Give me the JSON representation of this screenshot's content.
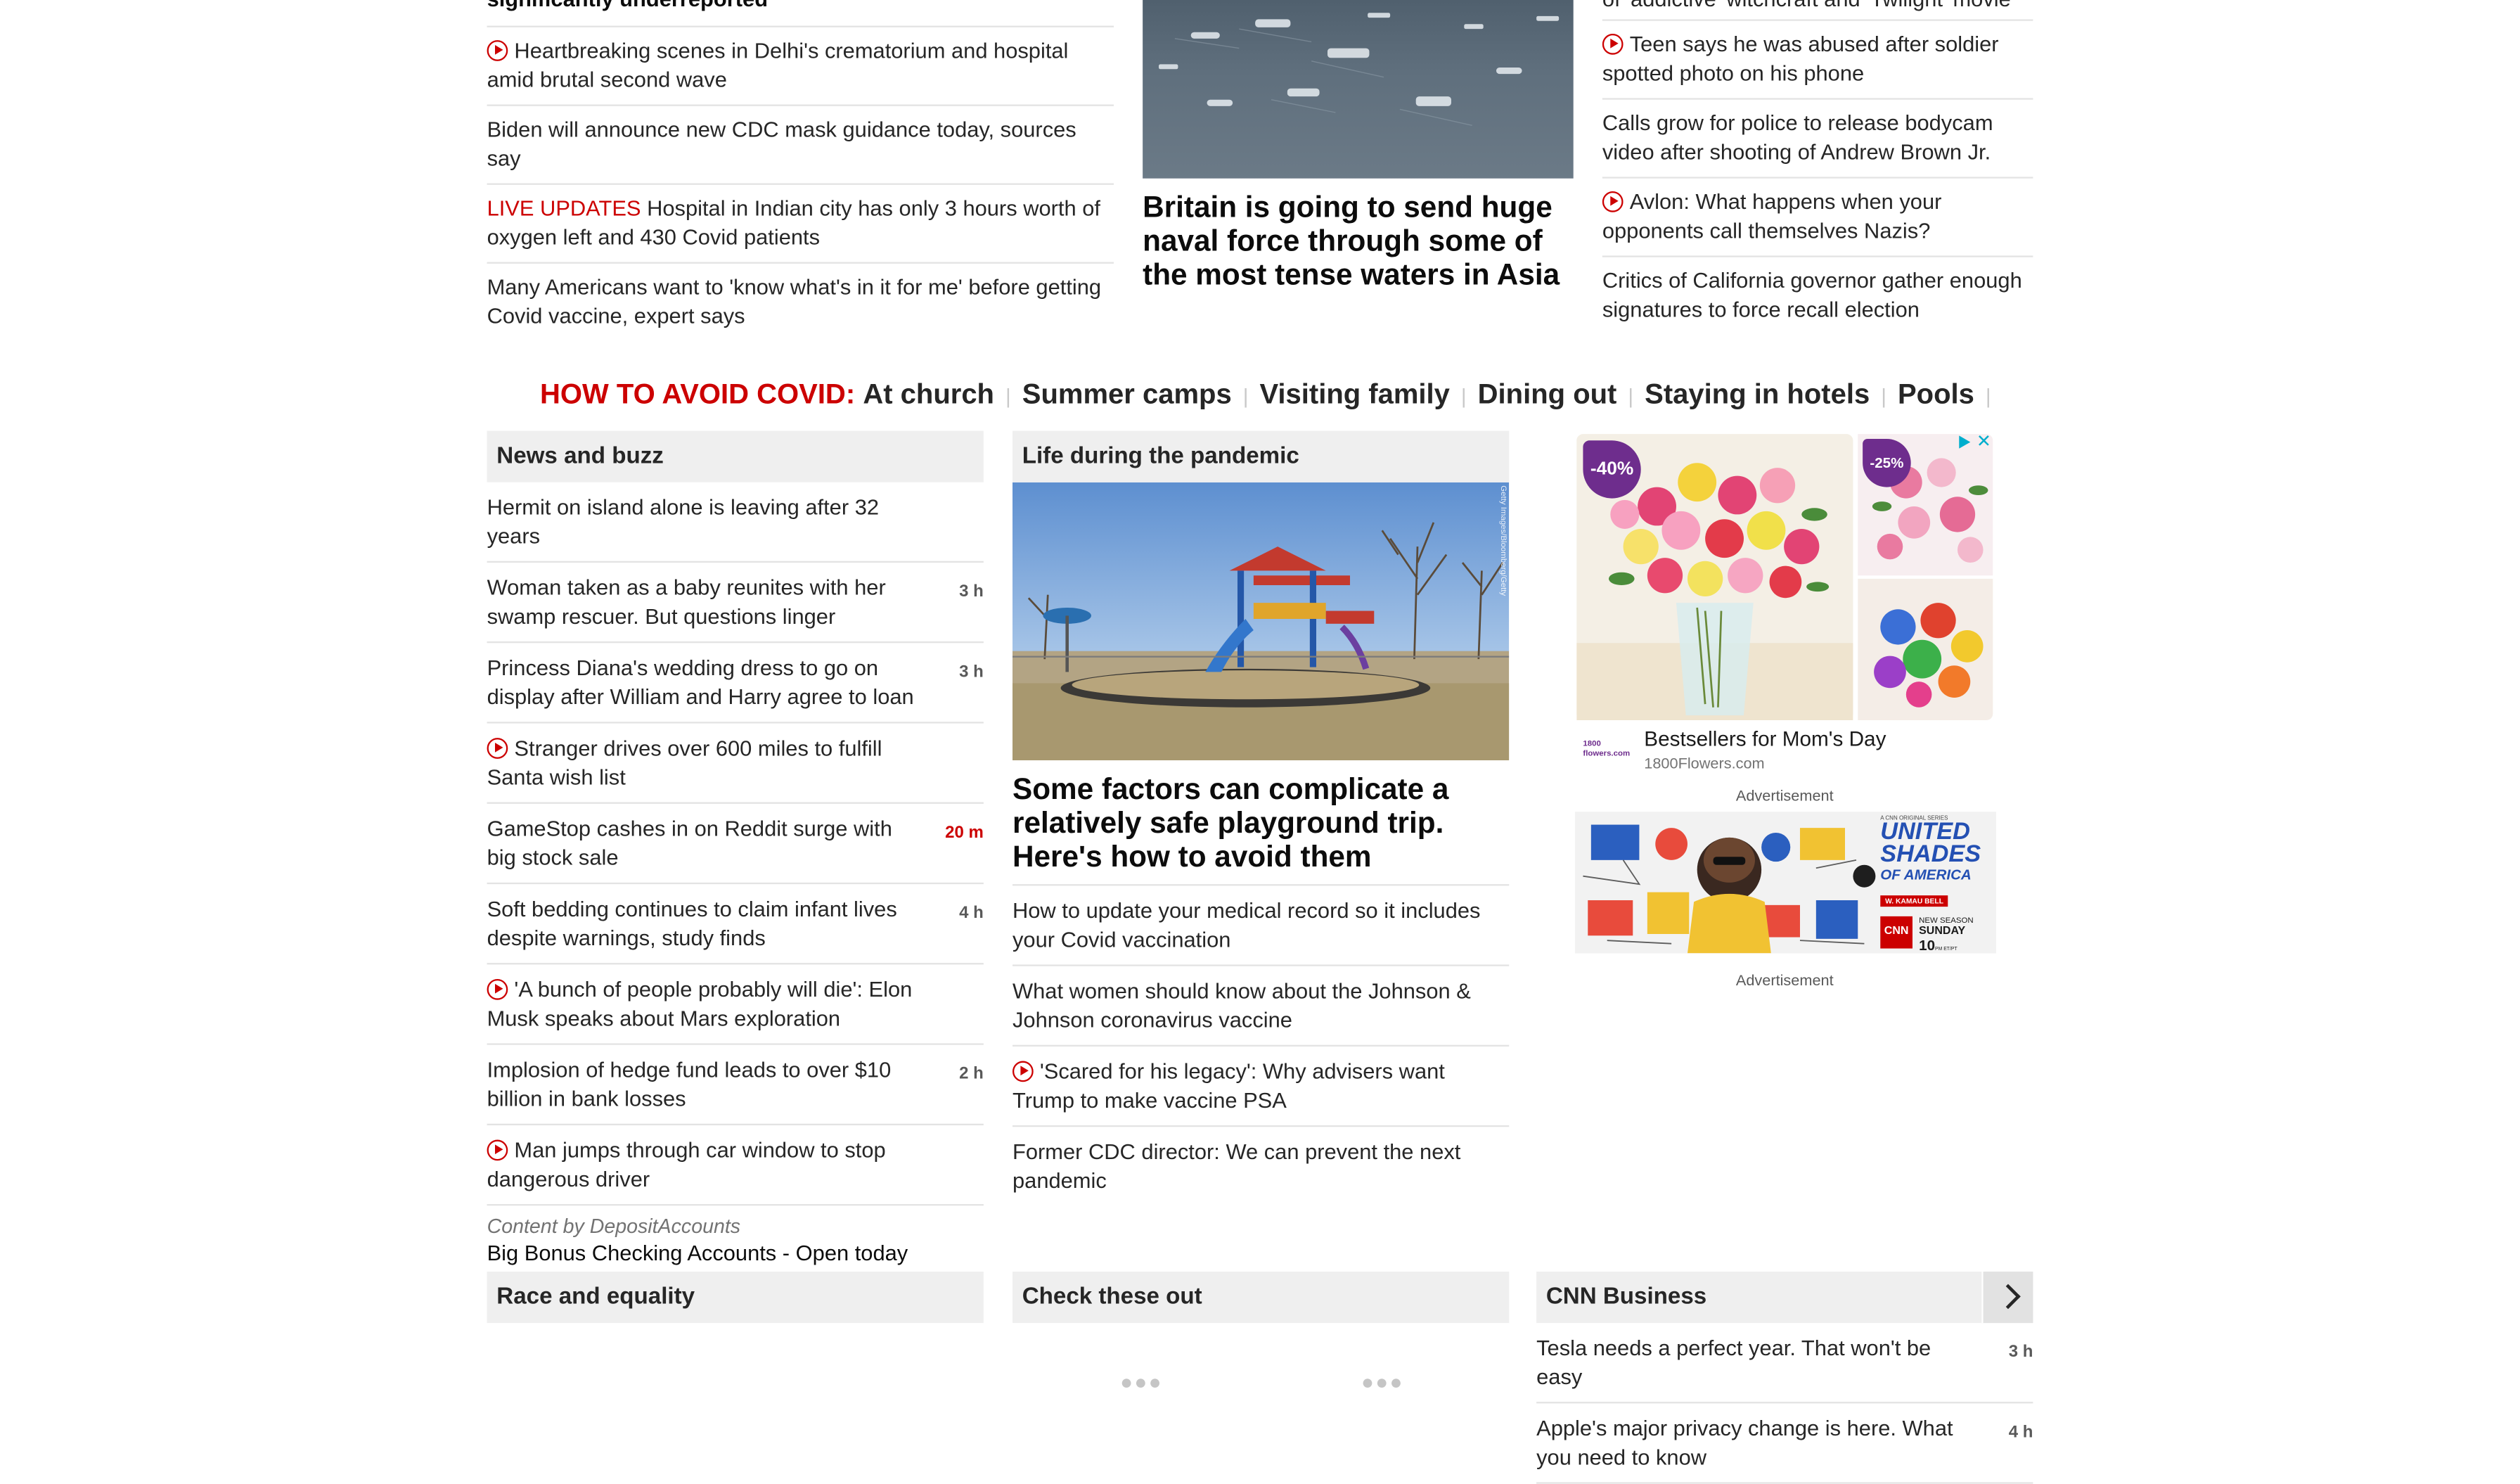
{
  "top_left": {
    "cut_headline": "significantly underreported",
    "stories": [
      {
        "video": true,
        "live": "",
        "text": "Heartbreaking scenes in Delhi's crematorium and hospital amid brutal second wave"
      },
      {
        "video": false,
        "live": "",
        "text": "Biden will announce new CDC mask guidance today, sources say"
      },
      {
        "video": false,
        "live": "LIVE UPDATES",
        "text": " Hospital in Indian city has only 3 hours worth of oxygen left and 430 Covid patients"
      },
      {
        "video": false,
        "live": "",
        "text": "Many Americans want to 'know what's in it for me' before getting Covid vaccine, expert says"
      }
    ]
  },
  "top_center": {
    "headline": "Britain is going to send huge naval force through some of the most tense waters in Asia"
  },
  "top_right": {
    "cut_headline": "of 'addictive' witchcraft and 'Twilight' movie",
    "stories": [
      {
        "video": true,
        "text": "Teen says he was abused after soldier spotted photo on his phone"
      },
      {
        "video": false,
        "text": "Calls grow for police to release bodycam video after shooting of Andrew Brown Jr."
      },
      {
        "video": true,
        "text": "Avlon: What happens when your opponents call themselves Nazis?"
      },
      {
        "video": false,
        "text": "Critics of California governor gather enough signatures to force recall election"
      }
    ]
  },
  "covid_bar": {
    "label": "HOW TO AVOID COVID:",
    "items": [
      "At church",
      "Summer camps",
      "Visiting family",
      "Dining out",
      "Staying in hotels",
      "Pools"
    ]
  },
  "news_buzz": {
    "title": "News and buzz",
    "stories": [
      {
        "video": false,
        "text": "Hermit on island alone is leaving after 32 years",
        "time": ""
      },
      {
        "video": false,
        "text": "Woman taken as a baby reunites with her swamp rescuer. But questions linger",
        "time": "3 h"
      },
      {
        "video": false,
        "text": "Princess Diana's wedding dress to go on display after William and Harry agree to loan",
        "time": "3 h"
      },
      {
        "video": true,
        "text": "Stranger drives over 600 miles to fulfill Santa wish list",
        "time": ""
      },
      {
        "video": false,
        "text": "GameStop cashes in on Reddit surge with big stock sale",
        "time": "20 m",
        "time_red": true
      },
      {
        "video": false,
        "text": "Soft bedding continues to claim infant lives despite warnings, study finds",
        "time": "4 h"
      },
      {
        "video": true,
        "text": "'A bunch of people probably will die': Elon Musk speaks about Mars exploration",
        "time": ""
      },
      {
        "video": false,
        "text": "Implosion of hedge fund leads to over $10 billion in bank losses",
        "time": "2 h"
      },
      {
        "video": true,
        "text": "Man jumps through car window to stop dangerous driver",
        "time": ""
      }
    ],
    "sponsor_label": "Content by DepositAccounts",
    "sponsor_link": "Big Bonus Checking Accounts - Open today"
  },
  "pandemic": {
    "title": "Life during the pandemic",
    "photo_credit": "Getty Images/Bloomberg/Getty",
    "headline": "Some factors can complicate a relatively safe playground trip. Here's how to avoid them",
    "stories": [
      {
        "video": false,
        "text": "How to update your medical record so it includes your Covid vaccination"
      },
      {
        "video": false,
        "text": "What women should know about the Johnson & Johnson coronavirus vaccine"
      },
      {
        "video": true,
        "text": "'Scared for his legacy': Why advisers want Trump to make vaccine PSA"
      },
      {
        "video": false,
        "text": "Former CDC director: We can prevent the next pandemic"
      }
    ]
  },
  "ad1": {
    "badge1": "-40%",
    "badge2": "-25%",
    "title": "Bestsellers for Mom's Day",
    "domain": "1800Flowers.com",
    "logo_text": "1800 flowers.com",
    "label": "Advertisement"
  },
  "ad2": {
    "kicker": "A CNN ORIGINAL SERIES",
    "title1": "UNITED",
    "title2": "SHADES",
    "title3": "OF AMERICA",
    "host": "W. KAMAU BELL",
    "cnn": "CNN",
    "season1": "NEW SEASON",
    "season2": "SUNDAY",
    "season3": "10",
    "season3_suffix": "PM ET/PT",
    "label": "Advertisement"
  },
  "bottom": {
    "race": "Race and equality",
    "check": "Check these out",
    "business": "CNN Business",
    "business_stories": [
      {
        "text": "Tesla needs a perfect year. That won't be easy",
        "time": "3 h"
      },
      {
        "text": "Apple's major privacy change is here. What you need to know",
        "time": "4 h"
      }
    ]
  },
  "colors": {
    "accent": "#cc0000",
    "section_bg": "#efefef"
  }
}
